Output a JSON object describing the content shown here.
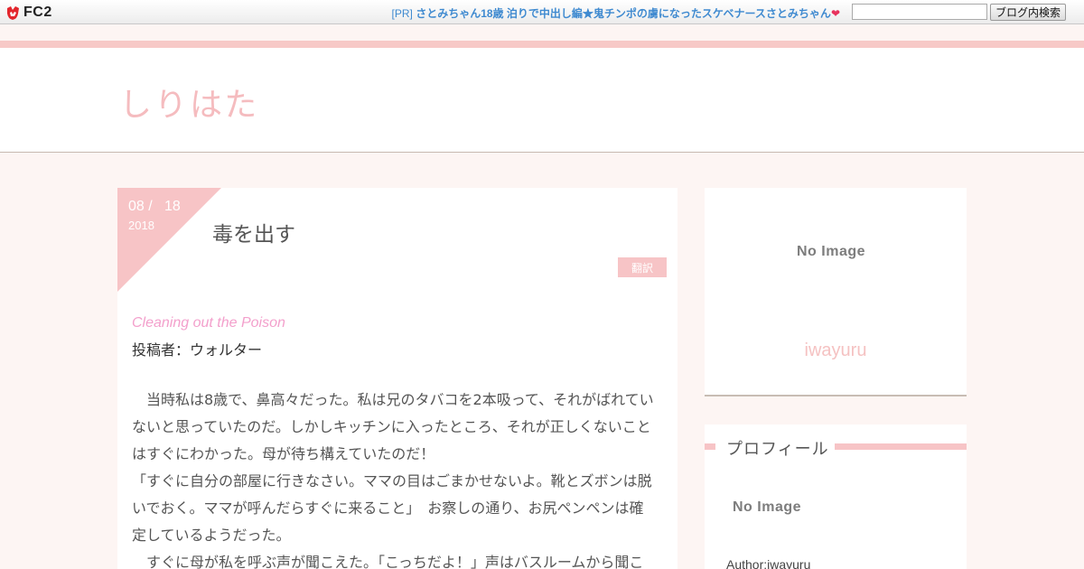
{
  "fc2bar": {
    "logo_text": "FC2",
    "pr_tag": "[PR]",
    "pr_link": "さとみちゃん18歳 泊りで中出し編★鬼チンポの虜になったスケベナースさとみちゃん",
    "pr_heart": "❤",
    "search_value": "",
    "search_button": "ブログ内検索"
  },
  "header": {
    "site_title": "しりはた"
  },
  "article": {
    "date_md": "08 /   18",
    "date_year": "2018",
    "title": "毒を出す",
    "category": "翻訳",
    "en_title": "Cleaning out the Poison",
    "poster": "投稿者：ウォルター",
    "paragraph": "　当時私は8歳で、鼻高々だった。私は兄のタバコを2本吸って、それがばれていないと思っていたのだ。しかしキッチンに入ったところ、それが正しくないことはすぐにわかった。母が待ち構えていたのだ！\n「すぐに自分の部屋に行きなさい。ママの目はごまかせないよ。靴とズボンは脱いでおく。ママが呼んだらすぐに来ること」　お察しの通り、お尻ペンペンは確定しているようだった。\n　すぐに母が私を呼ぶ声が聞こえた。「こっちだよ！」声はバスルームから聞こ"
  },
  "sidebar": {
    "card1_noimage": "No Image",
    "card1_name": "iwayuru",
    "profile_heading": "プロフィール",
    "profile_noimage": "No Image",
    "profile_author": "Author:iwayuru"
  },
  "colors": {
    "accent_pink": "#f7c4c6",
    "title_pink": "#f5bcbf",
    "en_title_pink": "#f3a0cc",
    "pr_link_blue": "#3f8ad0"
  }
}
